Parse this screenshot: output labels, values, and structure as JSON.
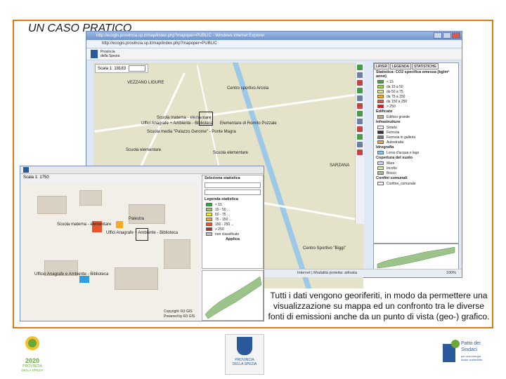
{
  "slide": {
    "title": "UN CASO PRATICO",
    "caption": "Tutti i dati vengono georiferiti,  in modo da permettere una visualizzazione su mappa ed un confronto tra le diverse fonti di emissioni anche da un punto di vista (geo-) grafico."
  },
  "browser_window": {
    "title": "http://ecogis.provincia.sp.it/map/index.php?mapoper=PUBLIC - Windows Internet Explorer",
    "address": "http://ecogis.provincia.sp.it/map/index.php?mapoper=PUBLIC",
    "app_name_line1": "Provincia",
    "app_name_line2": "della Spezia",
    "scale_label": "Scala 1:",
    "scale_value": "18183",
    "status_text": "Internet | Modalità protetta: attivata",
    "zoom_text": "100%",
    "map_labels": [
      "VEZZANO LIGURE",
      "Centro sportivo Arcola",
      "Scuola materna - elementare",
      "Uffici Anagrafe + Ambiente - Biblioteca",
      "Elementare di Romito Pozzale",
      "Scuola media \"Palazzo Gerome\" - Ponte Magra",
      "Scuola elementare",
      "Scuola elementare",
      "SARZANA",
      "Centro Sportivo \"Biggi\""
    ],
    "legend": {
      "tabs": [
        "LAYER",
        "LEGENDA",
        "STATISTICHE"
      ],
      "stat_title": "Statistica: CO2 specifica emessa (kg/m² anno)",
      "stat_items": [
        {
          "label": "< 15",
          "color": "#35a545"
        },
        {
          "label": "da 15 a 50",
          "color": "#9ad34a"
        },
        {
          "label": "da 50 a 75",
          "color": "#f2e83a"
        },
        {
          "label": "da 75 a 150",
          "color": "#f5a623"
        },
        {
          "label": "da 150 a 250",
          "color": "#e5542a"
        },
        {
          "label": "> 250",
          "color": "#d81e1e"
        }
      ],
      "section_edificato": "Edificato",
      "edificato_items": [
        {
          "label": "Edificio grande",
          "color": "#d2a468"
        }
      ],
      "section_infra": "Infrastrutture",
      "infra_items": [
        {
          "label": "Strada",
          "color": "#f3f3f3"
        },
        {
          "label": "Ferrovia",
          "color": "#333333"
        },
        {
          "label": "Ferrovia in galleria",
          "color": "#777777"
        },
        {
          "label": "Autostrada",
          "color": "#e8a040"
        }
      ],
      "section_idro": "Idrografia",
      "idro_items": [
        {
          "label": "Lorso d'acqua o lago",
          "color": "#8cc4ee"
        }
      ],
      "section_copertura": "Copertura del suolo",
      "copertura_items": [
        {
          "label": "Mare",
          "color": "#b8dcf2"
        },
        {
          "label": "Incolto",
          "color": "#cfe0a8"
        },
        {
          "label": "Bosco",
          "color": "#9cc48a"
        }
      ],
      "section_confini": "Confini comunali",
      "confini_items": [
        {
          "label": "Confine_comunale",
          "color": "#ffffff"
        }
      ]
    }
  },
  "detail_window": {
    "scale_label": "Scala 1:",
    "scale_value": "1750",
    "map_labels": [
      "Scuola materna - elementare",
      "Palestra",
      "Uffici Anagrafe + Ambiente - Biblioteca",
      "Ufficio Anagrafe e Ambiente - Biblioteca"
    ],
    "panel_items": [
      "Seleziona statistica",
      "Legenda statistica",
      "Applica"
    ],
    "legend_items": [
      {
        "label": "< 15",
        "color": "#35a545"
      },
      {
        "label": "15 - 50 ...",
        "color": "#9ad34a"
      },
      {
        "label": "50 - 75 ...",
        "color": "#f2e83a"
      },
      {
        "label": "75 - 150 ...",
        "color": "#f5a623"
      },
      {
        "label": "150 - 250 ...",
        "color": "#e5542a"
      },
      {
        "label": "> 250",
        "color": "#d81e1e"
      },
      {
        "label": "non classificato",
        "color": "#bbbbbb"
      }
    ],
    "footer1": "Copyright: R3 GIS",
    "footer2": "Powered by R3 GIS"
  },
  "logos": {
    "left_line1": "2020",
    "left_line2": "PROVINCIA",
    "left_line3": "DELLA SPEZIA",
    "middle_line1": "PROVINCIA",
    "middle_line2": "DELLA SPEZIA",
    "right_line1": "Patto dei",
    "right_line2": "Sindaci",
    "right_line3": "per una energia",
    "right_line4": "locale sostenibile"
  },
  "colors": {
    "frame": "#e07b12",
    "accent_blue": "#2b5a9c",
    "accent_green": "#6aa83a"
  }
}
